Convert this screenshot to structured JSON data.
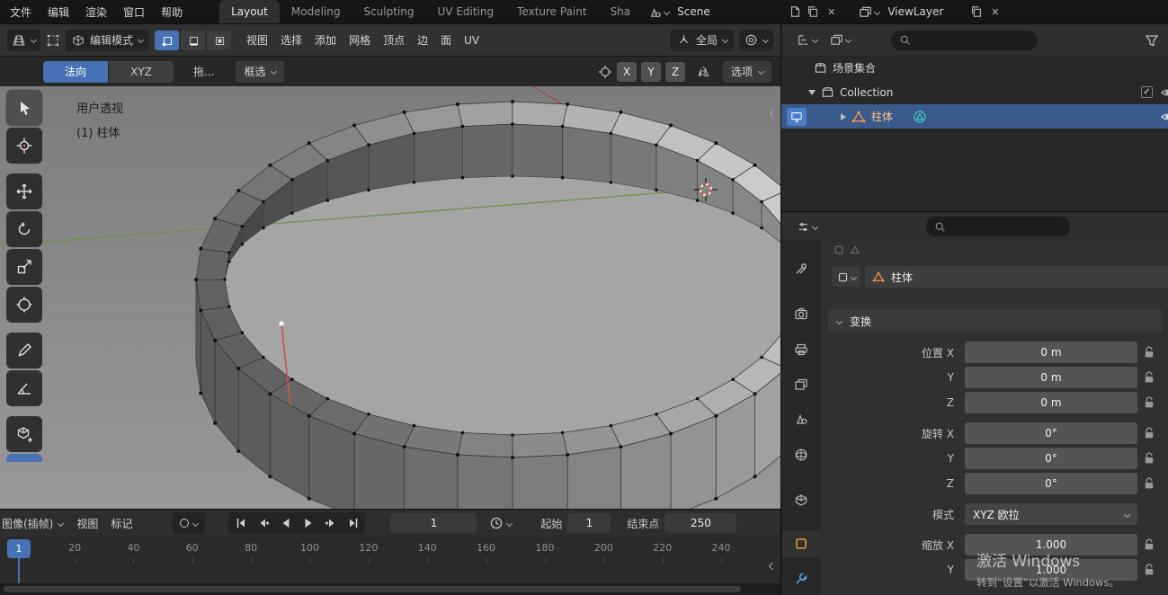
{
  "colors": {
    "accent": "#4772b3",
    "selection": "#3a5a8c",
    "object_orange": "#ff9a45",
    "mesh_teal": "#3ecfc3",
    "axis_green": "#6f8f3c",
    "axis_red": "#9d4a42"
  },
  "topbar": {
    "menus": [
      "文件",
      "编辑",
      "渲染",
      "窗口",
      "帮助"
    ],
    "workspaces": [
      "Layout",
      "Modeling",
      "Sculpting",
      "UV Editing",
      "Texture Paint",
      "Sha"
    ],
    "scene_label": "Scene",
    "viewlayer_label": "ViewLayer"
  },
  "viewport": {
    "header": {
      "mode": "编辑模式",
      "menus": [
        "视图",
        "选择",
        "添加",
        "网格",
        "顶点",
        "边",
        "面",
        "UV"
      ],
      "orientation": "全局"
    },
    "subheader": {
      "normal": "法向",
      "xyz": "XYZ",
      "drag": "拖...",
      "box_select": "框选",
      "axes": [
        "X",
        "Y",
        "Z"
      ],
      "options": "选项"
    },
    "overlay": {
      "perspective": "用户透视",
      "object": "(1) 柱体"
    }
  },
  "outliner": {
    "scene_collection": "场景集合",
    "collection": "Collection",
    "object": "柱体"
  },
  "properties": {
    "id_name": "柱体",
    "section": "变换",
    "rows": [
      {
        "label": "位置 X",
        "value": "0 m",
        "kind": "field",
        "lock": true
      },
      {
        "label": "Y",
        "value": "0 m",
        "kind": "field",
        "lock": true
      },
      {
        "label": "Z",
        "value": "0 m",
        "kind": "field",
        "lock": true,
        "gap_after": true
      },
      {
        "label": "旋转 X",
        "value": "0°",
        "kind": "field",
        "lock": true
      },
      {
        "label": "Y",
        "value": "0°",
        "kind": "field",
        "lock": true
      },
      {
        "label": "Z",
        "value": "0°",
        "kind": "field",
        "lock": true,
        "gap_after": true
      },
      {
        "label": "模式",
        "value": "XYZ 欧拉",
        "kind": "select",
        "gap_after": true
      },
      {
        "label": "缩放 X",
        "value": "1.000",
        "kind": "field",
        "lock": true
      },
      {
        "label": "Y",
        "value": "1.000",
        "kind": "field",
        "lock": true
      }
    ]
  },
  "timeline": {
    "editor_label": "图像(插帧)",
    "menus": [
      "视图",
      "标记"
    ],
    "current_frame": "1",
    "start_label": "起始",
    "start_value": "1",
    "end_label": "结束点",
    "end_value": "250",
    "current_marker": "1",
    "ticks": [
      "20",
      "40",
      "60",
      "80",
      "100",
      "120",
      "140",
      "160",
      "180",
      "200",
      "220",
      "240"
    ]
  },
  "watermark": {
    "line1": "激活 Windows",
    "line2": "转到“设置”以激活 Windows。"
  }
}
